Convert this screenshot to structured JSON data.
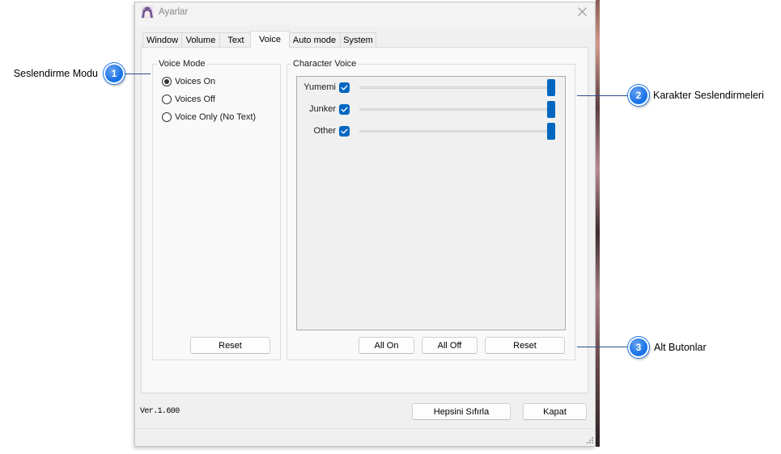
{
  "window": {
    "title": "Ayarlar"
  },
  "tabs": [
    {
      "label": "Window",
      "selected": false
    },
    {
      "label": "Volume",
      "selected": false
    },
    {
      "label": "Text",
      "selected": false
    },
    {
      "label": "Voice",
      "selected": true
    },
    {
      "label": "Auto mode",
      "selected": false
    },
    {
      "label": "System",
      "selected": false
    }
  ],
  "voice_mode": {
    "title": "Voice Mode",
    "options": [
      {
        "label": "Voices On",
        "checked": true
      },
      {
        "label": "Voices Off",
        "checked": false
      },
      {
        "label": "Voice Only (No Text)",
        "checked": false
      }
    ],
    "reset_label": "Reset"
  },
  "character_voice": {
    "title": "Character Voice",
    "characters": [
      {
        "name": "Yumemi",
        "enabled": true,
        "volume": 1.0
      },
      {
        "name": "Junker",
        "enabled": true,
        "volume": 1.0
      },
      {
        "name": "Other",
        "enabled": true,
        "volume": 1.0
      }
    ],
    "all_on_label": "All On",
    "all_off_label": "All Off",
    "reset_label": "Reset"
  },
  "footer": {
    "version": "Ver.1.600",
    "reset_all_label": "Hepsini Sıfırla",
    "close_label": "Kapat"
  },
  "annotations": [
    {
      "number": "1",
      "label": "Seslendirme Modu"
    },
    {
      "number": "2",
      "label": "Karakter Seslendirmeleri"
    },
    {
      "number": "3",
      "label": "Alt Butonlar"
    }
  ],
  "colors": {
    "accent": "#0067c0",
    "annotation": "#1a73e8",
    "callout_line": "#2a4f8f"
  }
}
